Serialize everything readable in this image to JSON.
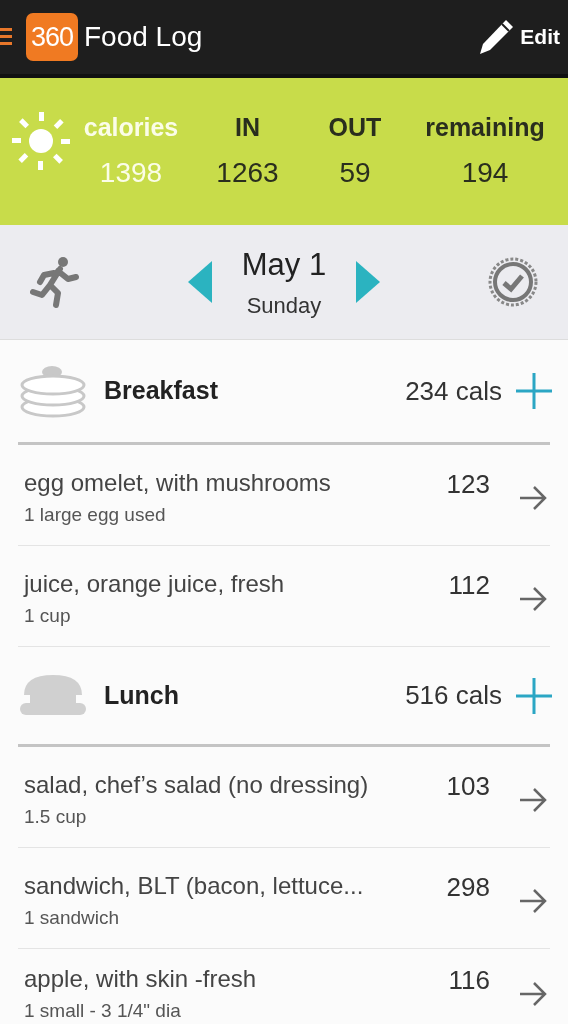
{
  "app_bar": {
    "logo": "360",
    "title": "Food Log",
    "action": "Edit"
  },
  "summary": [
    {
      "kind": "total",
      "label": "calories",
      "value": "1398"
    },
    {
      "kind": "part",
      "label": "IN",
      "value": "1263"
    },
    {
      "kind": "part",
      "label": "OUT",
      "value": "59"
    },
    {
      "kind": "part",
      "label": "remaining",
      "value": "194"
    }
  ],
  "date_bar": {
    "date": "May 1",
    "weekday": "Sunday"
  },
  "meals": [
    {
      "kind": "breakfast",
      "name": "Breakfast",
      "total": "234 cals",
      "items": [
        {
          "name": "egg omelet, with mushrooms",
          "portion": "1 large egg used",
          "calories": "123"
        },
        {
          "name": "juice, orange juice, fresh",
          "portion": "1 cup",
          "calories": "112"
        }
      ]
    },
    {
      "kind": "lunch",
      "name": "Lunch",
      "total": "516 cals",
      "items": [
        {
          "name": "salad, chef’s salad (no dressing)",
          "portion": "1.5 cup",
          "calories": "103"
        },
        {
          "name": "sandwich, BLT (bacon, lettuce...",
          "portion": "1 sandwich",
          "calories": "298"
        },
        {
          "name": "apple, with skin -fresh",
          "portion": "1 small - 3 1/4\" dia",
          "calories": "116"
        }
      ]
    }
  ]
}
